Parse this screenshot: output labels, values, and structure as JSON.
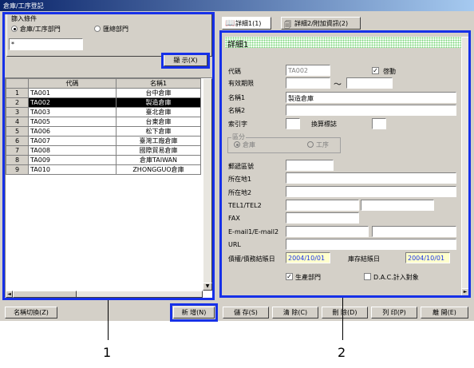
{
  "window": {
    "title": "倉庫/工序登記"
  },
  "left_panel": {
    "filter_group_label": "篩入條件",
    "radio_warehouse": "倉庫/工序部門",
    "radio_account": "匯總部門",
    "filter_value": "*",
    "show_button": "顯 示(X)",
    "columns": {
      "code": "代碼",
      "name": "名稱1"
    },
    "rows": [
      {
        "n": "1",
        "code": "TA001",
        "name": "台中倉庫"
      },
      {
        "n": "2",
        "code": "TA002",
        "name": "製造倉庫"
      },
      {
        "n": "3",
        "code": "TA003",
        "name": "臺北倉庫"
      },
      {
        "n": "4",
        "code": "TA005",
        "name": "台東倉庫"
      },
      {
        "n": "5",
        "code": "TA006",
        "name": "松下倉庫"
      },
      {
        "n": "6",
        "code": "TA007",
        "name": "臺灣工廠倉庫"
      },
      {
        "n": "7",
        "code": "TA008",
        "name": "國際貿易倉庫"
      },
      {
        "n": "8",
        "code": "TA009",
        "name": "倉庫TAIWAN"
      },
      {
        "n": "9",
        "code": "TA010",
        "name": "ZHONGGUO倉庫"
      }
    ]
  },
  "tabs": {
    "tab1": "詳細1(1)",
    "tab2": "詳細2/附加資訊(2)"
  },
  "detail": {
    "heading": "詳細1",
    "code_label": "代碼",
    "code_value": "TA002",
    "active_label": "啓動",
    "validity_label": "有效期限",
    "tilde": "～",
    "name1_label": "名稱1",
    "name1_value": "製造倉庫",
    "name2_label": "名稱2",
    "index_label": "索引字",
    "transfer_label": "換算標誌",
    "category_label": "區分",
    "cat_warehouse": "倉庫",
    "cat_process": "工序",
    "postal_label": "郵遞區號",
    "address1_label": "所在地1",
    "address2_label": "所在地2",
    "tel_label": "TEL1/TEL2",
    "fax_label": "FAX",
    "email_label": "E-mail1/E-mail2",
    "url_label": "URL",
    "closing_label": "債權/債務結賬日",
    "closing_value": "2004/10/01",
    "stock_closing_label": "庫存結賬日",
    "stock_closing_value": "2004/10/01",
    "production_label": "生產部門",
    "dac_label": "D.A.C.計入對象"
  },
  "buttons": {
    "switch_name": "名稱切換(Z)",
    "new": "新 增(N)",
    "save": "儲 存(S)",
    "clear": "清 除(C)",
    "delete": "刪 除(D)",
    "print": "列 印(P)",
    "exit": "離 開(E)"
  },
  "callouts": {
    "one": "1",
    "two": "2"
  },
  "colors": {
    "highlight_frame": "#1630e8",
    "title_bar": "#0a246a",
    "date_field": "#ffffcc"
  }
}
